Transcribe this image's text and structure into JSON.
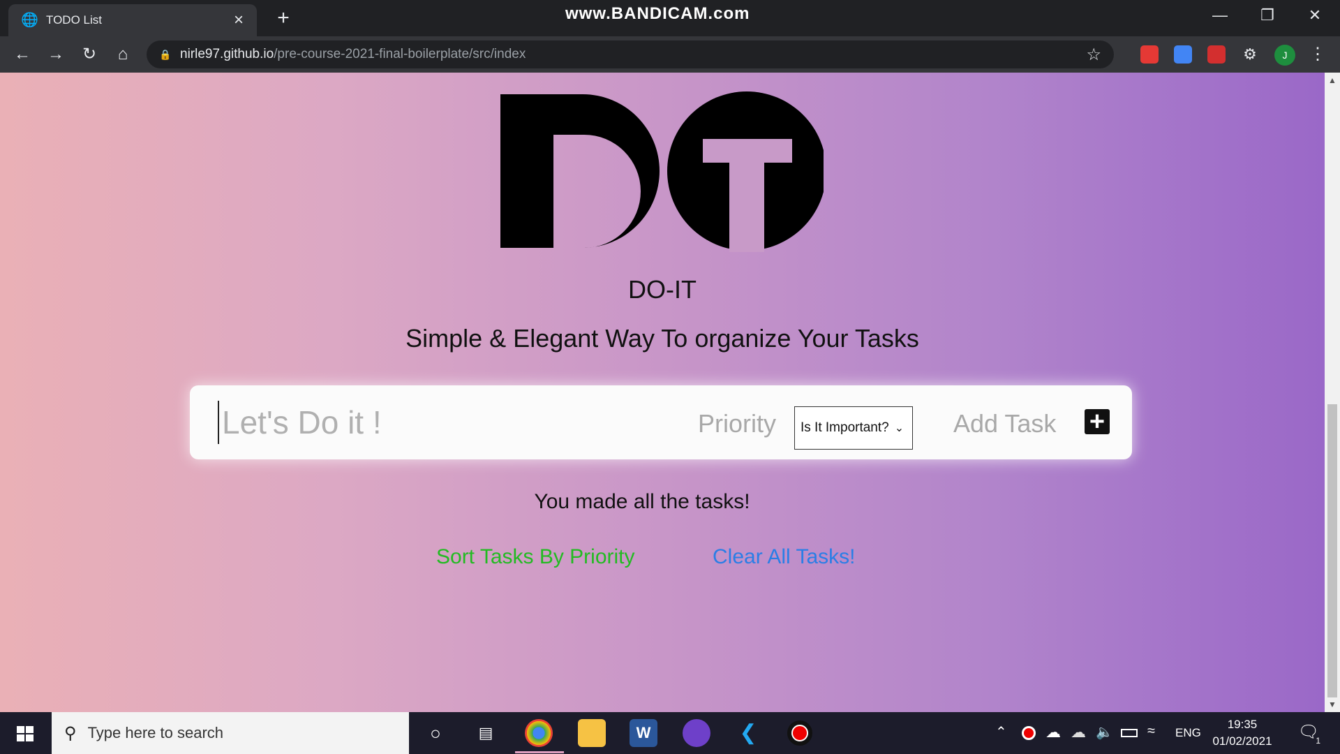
{
  "browser": {
    "tab_title": "TODO List",
    "watermark": "www.BANDICAM.com",
    "url_host": "nirle97.github.io",
    "url_path": "/pre-course-2021-final-boilerplate/src/index",
    "profile_initial": "J"
  },
  "app": {
    "name": "DO-IT",
    "tagline": "Simple & Elegant Way To organize Your Tasks",
    "input_placeholder": "Let's Do it !",
    "priority_label": "Priority",
    "priority_select_value": "Is It Important?",
    "add_label": "Add Task",
    "add_icon": "+",
    "status_message": "You made all the tasks!",
    "sort_link": "Sort Tasks By Priority",
    "clear_link": "Clear All Tasks!"
  },
  "colors": {
    "sort_link": "#22bb22",
    "clear_link": "#2a7ee6",
    "gradient_start": "#eab0b6",
    "gradient_end": "#9a68c8"
  },
  "taskbar": {
    "search_placeholder": "Type here to search",
    "language": "ENG",
    "time": "19:35",
    "date": "01/02/2021",
    "notification_count": "1",
    "apps": [
      "cortana-icon",
      "task-view-icon",
      "chrome-icon",
      "file-explorer-icon",
      "word-icon",
      "github-desktop-icon",
      "vscode-icon",
      "bandicam-icon"
    ]
  }
}
